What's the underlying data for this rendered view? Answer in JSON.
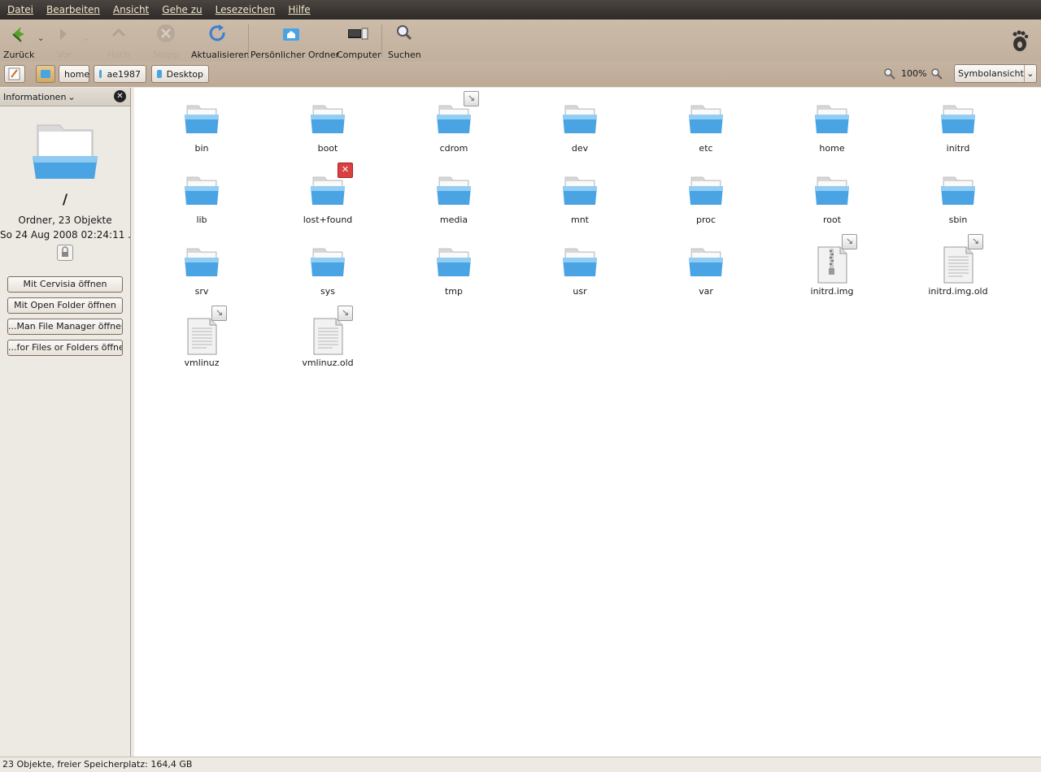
{
  "menubar": [
    "Datei",
    "Bearbeiten",
    "Ansicht",
    "Gehe zu",
    "Lesezeichen",
    "Hilfe"
  ],
  "toolbar": {
    "back": "Zurück",
    "forward": "Vor",
    "up": "Hoch",
    "stop": "Stopp",
    "reload": "Aktualisieren",
    "home": "Persönlicher Ordner",
    "computer": "Computer",
    "search": "Suchen"
  },
  "location": {
    "crumbs": [
      "home",
      "ae1987",
      "Desktop"
    ],
    "zoom": "100%",
    "view": "Symbolansicht"
  },
  "sidebar": {
    "header": "Informationen",
    "name": "/",
    "type": "Ordner, 23 Objekte",
    "date": "So 24 Aug 2008 02:24:11 ...",
    "buttons": [
      "Mit Cervisia öffnen",
      "Mit Open Folder öffnen",
      "...Man File Manager öffnen",
      "...for Files or Folders öffnen"
    ]
  },
  "files": [
    {
      "name": "bin",
      "kind": "folder"
    },
    {
      "name": "boot",
      "kind": "folder"
    },
    {
      "name": "cdrom",
      "kind": "folder",
      "emblem": "link"
    },
    {
      "name": "dev",
      "kind": "folder"
    },
    {
      "name": "etc",
      "kind": "folder"
    },
    {
      "name": "home",
      "kind": "folder"
    },
    {
      "name": "initrd",
      "kind": "folder"
    },
    {
      "name": "lib",
      "kind": "folder"
    },
    {
      "name": "lost+found",
      "kind": "folder",
      "emblem": "unreadable"
    },
    {
      "name": "media",
      "kind": "folder"
    },
    {
      "name": "mnt",
      "kind": "folder"
    },
    {
      "name": "proc",
      "kind": "folder"
    },
    {
      "name": "root",
      "kind": "folder"
    },
    {
      "name": "sbin",
      "kind": "folder"
    },
    {
      "name": "srv",
      "kind": "folder"
    },
    {
      "name": "sys",
      "kind": "folder"
    },
    {
      "name": "tmp",
      "kind": "folder"
    },
    {
      "name": "usr",
      "kind": "folder"
    },
    {
      "name": "var",
      "kind": "folder"
    },
    {
      "name": "initrd.img",
      "kind": "archive",
      "emblem": "link"
    },
    {
      "name": "initrd.img.old",
      "kind": "text",
      "emblem": "link"
    },
    {
      "name": "vmlinuz",
      "kind": "text",
      "emblem": "link"
    },
    {
      "name": "vmlinuz.old",
      "kind": "text",
      "emblem": "link"
    }
  ],
  "status": "23 Objekte, freier Speicherplatz: 164,4 GB"
}
